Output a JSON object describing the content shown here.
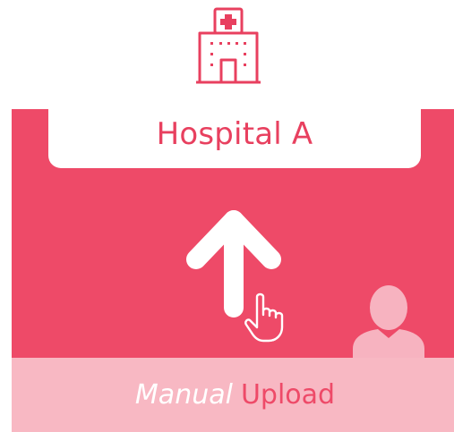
{
  "hospital": {
    "name": "Hospital A",
    "icon": "hospital-building-icon"
  },
  "upload": {
    "mode_word": "Manual",
    "action_word": "Upload",
    "arrow_icon": "upload-arrow-icon",
    "hand_icon": "pointing-hand-icon",
    "person_icon": "person-icon"
  },
  "colors": {
    "accent": "#ee4a68",
    "footer_band": "#f8b8c3",
    "card": "#ffffff",
    "person_silhouette": "#f7b3c0"
  }
}
